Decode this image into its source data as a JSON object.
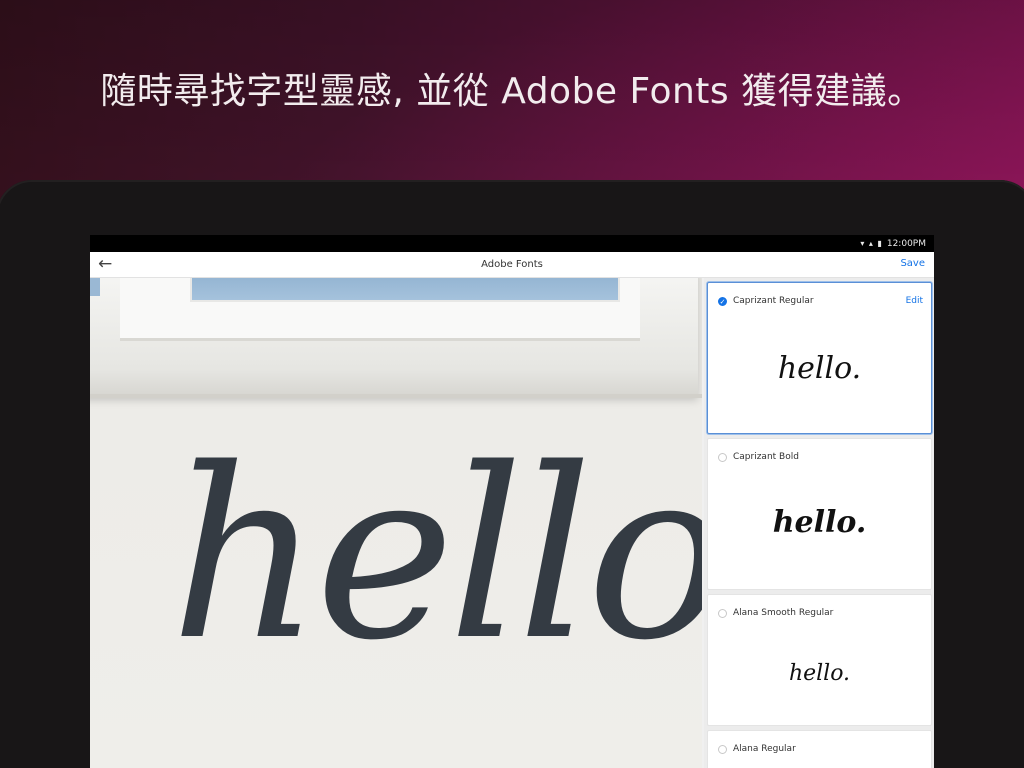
{
  "headline": "隨時尋找字型靈感, 並從 Adobe Fonts 獲得建議。",
  "statusbar": {
    "icons": "▾ ▴ ▮",
    "time": "12:00PM"
  },
  "appbar": {
    "back_icon": "←",
    "title": "Adobe Fonts",
    "save_label": "Save"
  },
  "photo": {
    "text": "hello."
  },
  "fonts": [
    {
      "name": "Caprizant Regular",
      "sample": "hello.",
      "selected": true,
      "edit_label": "Edit"
    },
    {
      "name": "Caprizant Bold",
      "sample": "hello.",
      "selected": false
    },
    {
      "name": "Alana Smooth Regular",
      "sample": "hello.",
      "selected": false
    },
    {
      "name": "Alana Regular",
      "sample": "",
      "selected": false
    }
  ],
  "colors": {
    "accent": "#1473e6",
    "background_start": "#3a1220",
    "background_end": "#8a1758",
    "ink": "#343b43"
  }
}
